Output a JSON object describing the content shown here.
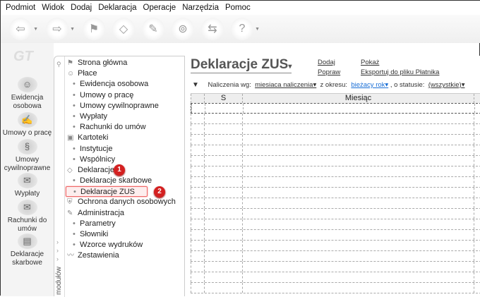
{
  "menu": [
    "Podmiot",
    "Widok",
    "Dodaj",
    "Deklaracja",
    "Operacje",
    "Narzędzia",
    "Pomoc"
  ],
  "toolbar": [
    "back-icon",
    "forward-icon",
    "home-icon",
    "document-icon",
    "sign-icon",
    "stamp-icon",
    "export-icon",
    "help-icon"
  ],
  "left_buttons": [
    {
      "label": "Ewidencja osobowa",
      "icon": "people-icon"
    },
    {
      "label": "Umowy o pracę",
      "icon": "contract-icon"
    },
    {
      "label": "Umowy cywilnoprawne",
      "icon": "civil-contract-icon"
    },
    {
      "label": "Wypłaty",
      "icon": "payout-icon"
    },
    {
      "label": "Rachunki do umów",
      "icon": "bill-icon"
    },
    {
      "label": "Deklaracje skarbowe",
      "icon": "tax-declaration-icon"
    }
  ],
  "nav": {
    "strip_label": "modułów",
    "items": [
      {
        "label": "Strona główna",
        "level": 0
      },
      {
        "label": "Płace",
        "level": 0
      },
      {
        "label": "Ewidencja osobowa",
        "level": 1
      },
      {
        "label": "Umowy o pracę",
        "level": 1
      },
      {
        "label": "Umowy cywilnoprawne",
        "level": 1
      },
      {
        "label": "Wypłaty",
        "level": 1
      },
      {
        "label": "Rachunki do umów",
        "level": 1
      },
      {
        "label": "Kartoteki",
        "level": 0
      },
      {
        "label": "Instytucje",
        "level": 1
      },
      {
        "label": "Wspólnicy",
        "level": 1
      },
      {
        "label": "Deklaracje",
        "level": 0
      },
      {
        "label": "Deklaracje skarbowe",
        "level": 1
      },
      {
        "label": "Deklaracje ZUS",
        "level": 1
      },
      {
        "label": "Ochrona danych osobowych",
        "level": 0
      },
      {
        "label": "Administracja",
        "level": 0
      },
      {
        "label": "Parametry",
        "level": 1
      },
      {
        "label": "Słowniki",
        "level": 1
      },
      {
        "label": "Wzorce wydruków",
        "level": 1
      },
      {
        "label": "Zestawienia",
        "level": 0
      }
    ]
  },
  "badges": [
    "1",
    "2"
  ],
  "main": {
    "title": "Deklaracje ZUS",
    "actions": {
      "add": "Dodaj",
      "edit": "Popraw",
      "show": "Pokaż",
      "export": "Eksportuj do pliku Płatnika"
    },
    "filter": {
      "label1": "Naliczenia wg:",
      "value1": "miesiaca naliczenia",
      "label2": "z okresu:",
      "value2": "bieżacy rok",
      "label3": ", o statusie:",
      "value3": "(wszystkie)"
    },
    "columns": [
      "S",
      "Miesiąc"
    ]
  },
  "colors": {
    "badge": "#d42020",
    "link_blue": "#1a6fd6"
  }
}
